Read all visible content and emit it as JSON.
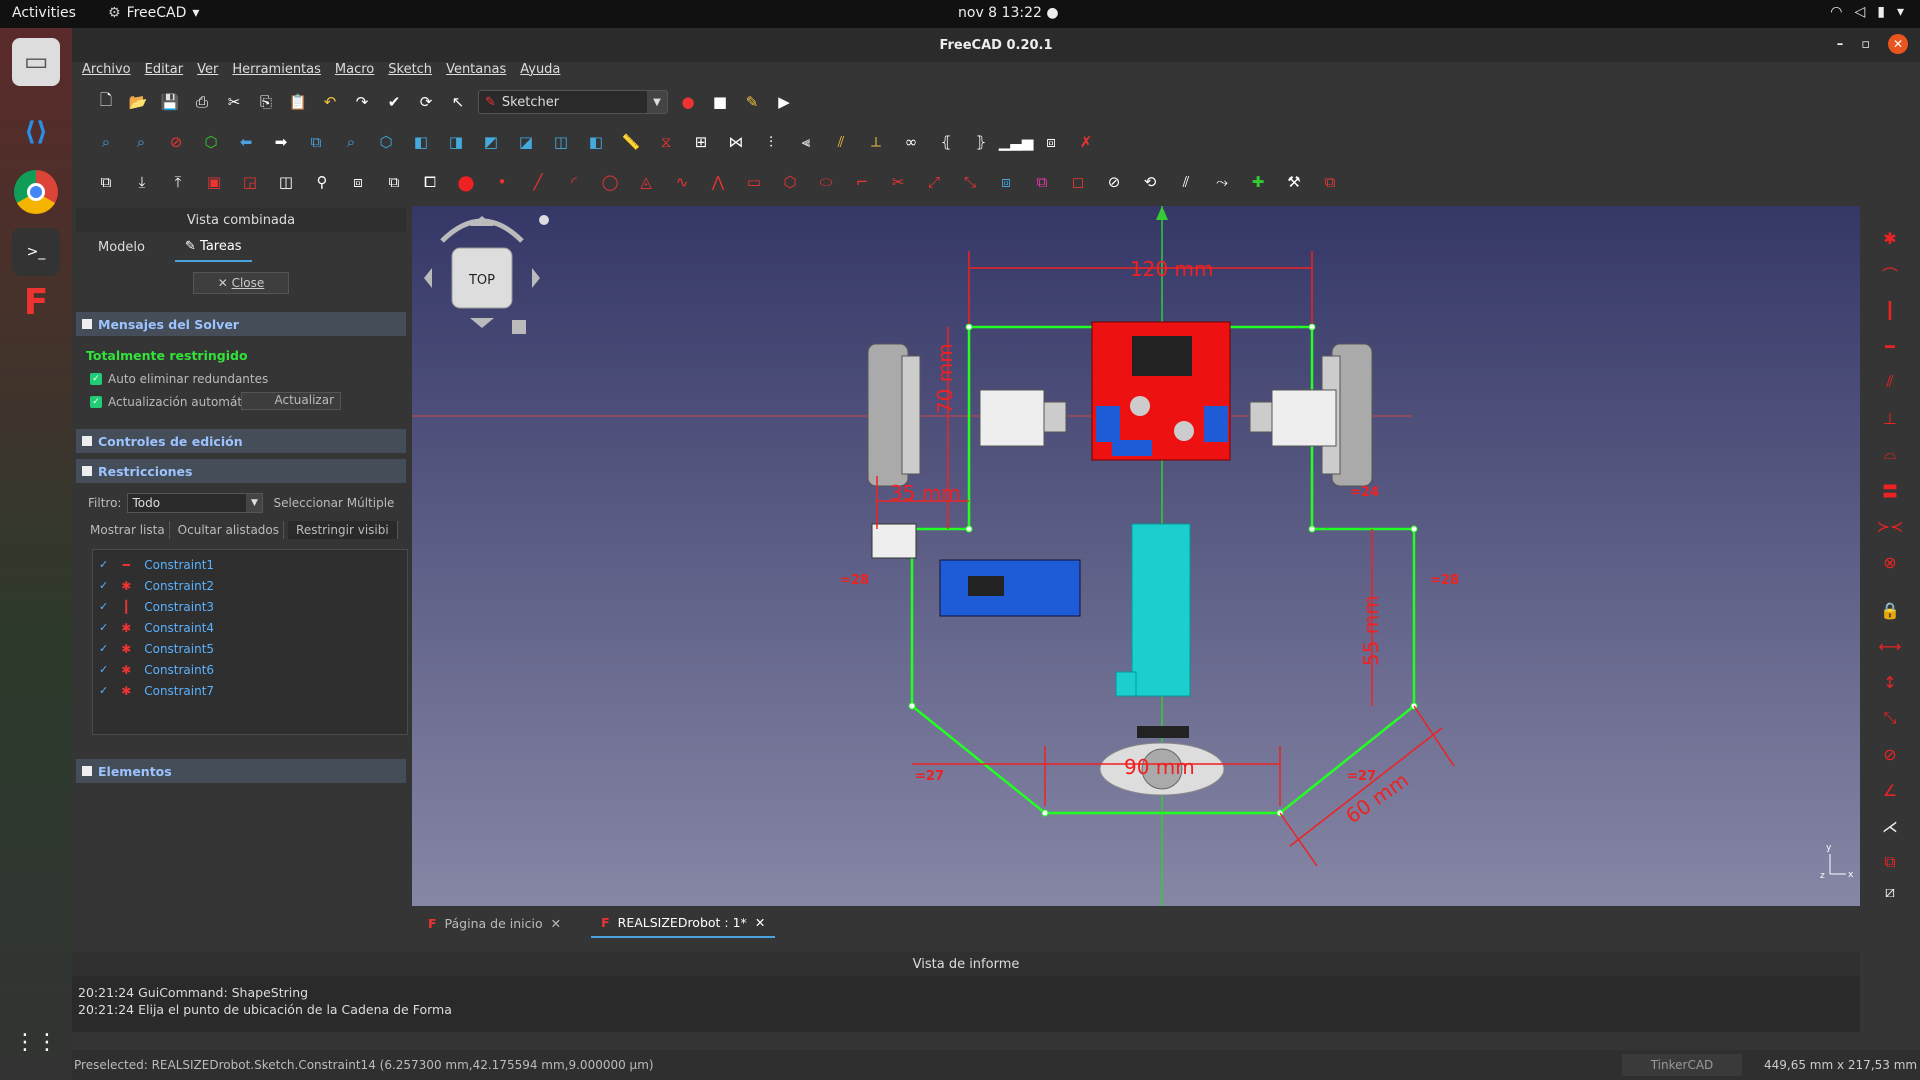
{
  "system": {
    "activities": "Activities",
    "app_name": "FreeCAD",
    "clock": "nov 8  13:22"
  },
  "window": {
    "title": "FreeCAD 0.20.1"
  },
  "menu": [
    "Archivo",
    "Editar",
    "Ver",
    "Herramientas",
    "Macro",
    "Sketch",
    "Ventanas",
    "Ayuda"
  ],
  "toolbar": {
    "workbench": "Sketcher"
  },
  "combo_view": {
    "title": "Vista combinada",
    "tabs": [
      "Modelo",
      "Tareas"
    ],
    "close_label": "Close",
    "solver_section": "Mensajes del Solver",
    "solver_status": "Totalmente restringido",
    "auto_remove": "Auto eliminar redundantes",
    "auto_update": "Actualización automática",
    "update_button": "Actualizar",
    "edit_controls": "Controles de edición",
    "constraints_section": "Restricciones",
    "filter_label": "Filtro:",
    "filter_value": "Todo",
    "multi_select": "Seleccionar Múltiple",
    "show_list": "Mostrar lista",
    "hide_listed": "Ocultar alistados",
    "restrict_visible": "Restringir visibi",
    "constraints": [
      "Constraint1",
      "Constraint2",
      "Constraint3",
      "Constraint4",
      "Constraint5",
      "Constraint6",
      "Constraint7"
    ],
    "elements_section": "Elementos"
  },
  "viewport": {
    "cube_face": "TOP",
    "dim_width": "120 mm",
    "dim_height": "70 mm",
    "dim_side": "35 mm",
    "dim_right": "55 mm",
    "dim_bottom": "90 mm",
    "dim_diag": "60 mm",
    "eq_left": "=28",
    "eq_right": "=28",
    "eq_bl": "=27",
    "eq_br": "=27",
    "eq_top": "=24"
  },
  "doc_tabs": [
    "Página de inicio",
    "REALSIZEDrobot : 1*"
  ],
  "report": {
    "title": "Vista de informe",
    "lines": [
      "20:21:24  GuiCommand: ShapeString",
      "20:21:24  Elija el punto de ubicación de la Cadena de Forma"
    ]
  },
  "status": {
    "preselected": "Preselected: REALSIZEDrobot.Sketch.Constraint14 (6.257300 mm,42.175594 mm,9.000000 µm)",
    "nav_style": "TinkerCAD",
    "dimensions": "449,65 mm x 217,53 mm"
  }
}
